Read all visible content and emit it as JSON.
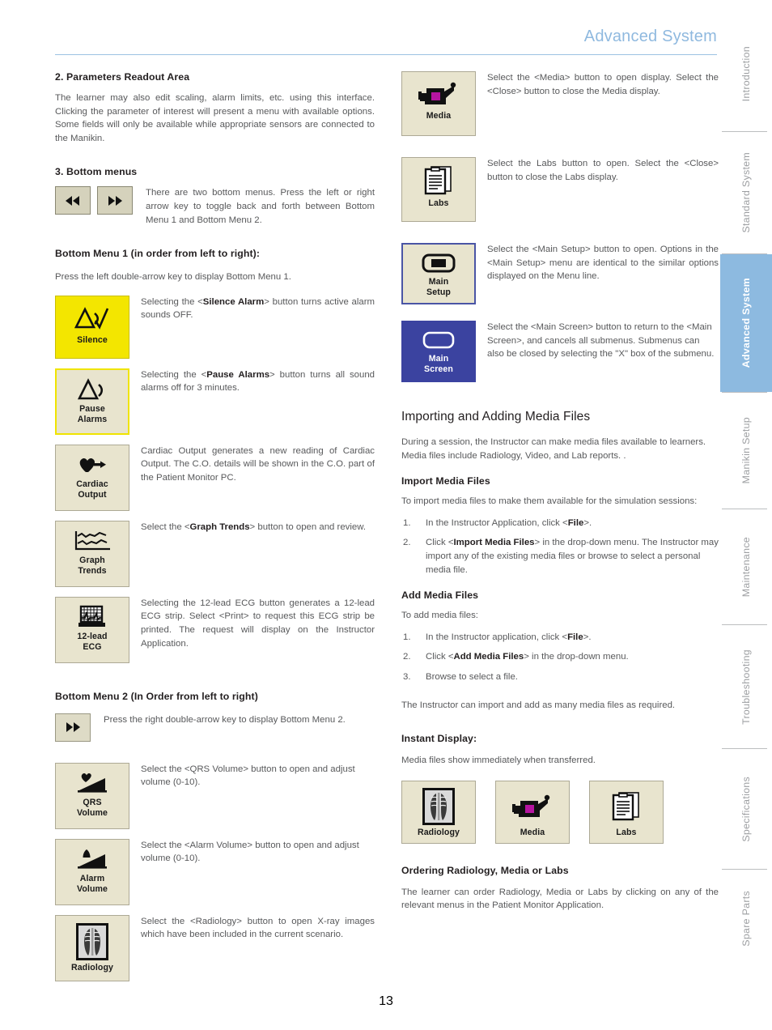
{
  "header": {
    "title": "Advanced System"
  },
  "page_number": "13",
  "colors": {
    "header_blue": "#8FB9DF",
    "active_tab": "#8DBAE0",
    "button_beige": "#E8E4CE",
    "silence_yellow": "#F3E600",
    "main_screen_blue": "#3B43A0"
  },
  "sidebar": {
    "tabs": [
      {
        "label": "Introduction",
        "active": false
      },
      {
        "label": "Standard System",
        "active": false
      },
      {
        "label": "Advanced System",
        "active": true
      },
      {
        "label": "Manikin Setup",
        "active": false
      },
      {
        "label": "Maintenance",
        "active": false
      },
      {
        "label": "Troubleshooting",
        "active": false
      },
      {
        "label": "Specifications",
        "active": false
      },
      {
        "label": "Spare Parts",
        "active": false
      }
    ]
  },
  "left_column": {
    "section2_heading": "2.  Parameters Readout  Area",
    "section2_body": "The learner may also edit scaling, alarm limits, etc. using this interface. Clicking the parameter of interest will present a menu with available options. Some fields will only be available while appropriate sensors are connected to the Manikin.",
    "section3_heading": "3.  Bottom menus",
    "bottom_menus_text": "There are two bottom menus.  Press the left or right arrow key to toggle back and forth between Bottom Menu 1 and Bottom Menu 2.",
    "bottom_menu1_heading": "Bottom Menu 1 (in order from left to right):",
    "bottom_menu1_intro": "Press the left double-arrow key to display Bottom Menu 1.",
    "buttons": [
      {
        "label": "Silence",
        "icon": "silence-alarm-icon",
        "style": "yellow",
        "desc_pre": "Selecting the <",
        "desc_bold": "Silence Alarm",
        "desc_post": "> button turns active alarm sounds OFF."
      },
      {
        "label_line1": "Pause",
        "label_line2": "Alarms",
        "icon": "pause-alarms-icon",
        "style": "yellow-border",
        "desc_pre": "Selecting the <",
        "desc_bold": "Pause Alarms",
        "desc_post": "> button turns all sound alarms off for 3 minutes."
      },
      {
        "label_line1": "Cardiac",
        "label_line2": "Output",
        "icon": "cardiac-output-icon",
        "style": "plain",
        "desc": "Cardiac Output generates a new reading of Cardiac Output. The C.O. details will be shown in the C.O. part of the Patient Monitor PC."
      },
      {
        "label_line1": "Graph",
        "label_line2": "Trends",
        "icon": "graph-trends-icon",
        "style": "plain",
        "desc_pre": "Select the <",
        "desc_bold": "Graph Trends",
        "desc_post": "> button  to open and review."
      },
      {
        "label_line1": "12-lead",
        "label_line2": "ECG",
        "icon": "twelve-lead-ecg-icon",
        "style": "plain",
        "desc": "Selecting the 12-lead ECG button generates a 12-lead ECG strip.  Select <Print> to request this ECG strip be printed.  The request will display on the Instructor Application."
      }
    ],
    "bottom_menu2_heading": "Bottom Menu 2 (In Order from left to right)",
    "bottom_menu2_intro": "Press the right double-arrow key to display Bottom Menu 2.",
    "buttons2": [
      {
        "label_line1": "QRS",
        "label_line2": "Volume",
        "icon": "qrs-volume-icon",
        "desc": "Select the <QRS Volume> button to open and adjust volume (0-10)."
      },
      {
        "label_line1": "Alarm",
        "label_line2": "Volume",
        "icon": "alarm-volume-icon",
        "desc": "Select the <Alarm Volume> button to open and adjust volume (0-10)."
      },
      {
        "label": "Radiology",
        "icon": "radiology-xray-icon",
        "desc": "Select the <Radiology> button to open X-ray images which have been included in the current scenario."
      }
    ]
  },
  "right_column": {
    "buttons": [
      {
        "label": "Media",
        "icon": "media-camcorder-icon",
        "style": "plain",
        "desc": "Select the <Media> button to open display.  Select the <Close> button to close the Media display."
      },
      {
        "label": "Labs",
        "icon": "labs-documents-icon",
        "style": "plain",
        "desc": "Select the Labs button to open. Select the <Close> button to close the Labs display."
      },
      {
        "label_line1": "Main",
        "label_line2": "Setup",
        "icon": "main-setup-icon",
        "style": "blue-border",
        "desc": "Select the <Main Setup> button to open. Options in the <Main Setup> menu are identical to the similar options displayed on the Menu line."
      },
      {
        "label_line1": "Main",
        "label_line2": "Screen",
        "icon": "main-screen-icon",
        "style": "blue-fill",
        "desc": "Select the <Main Screen> button to return to the <Main Screen>, and cancels all submenus. Submenus can also be closed by selecting the \"X\" box of the submenu."
      }
    ],
    "importing_heading": "Importing and Adding Media Files",
    "importing_body": "During a session, the Instructor can make media files available to learners. Media files include Radiology, Video, and Lab reports. .",
    "import_heading": "Import Media Files",
    "import_intro": "To import media files to make them available for the simulation sessions:",
    "import_steps": [
      {
        "num": "1.",
        "pre": "In the Instructor Application, click <",
        "bold": "File",
        "post": ">."
      },
      {
        "num": "2.",
        "pre": "Click <",
        "bold": "Import Media Files",
        "post": "> in the drop-down menu. The Instructor may import any of the existing media files or browse to select a personal media file."
      }
    ],
    "add_heading": "Add Media Files",
    "add_intro": "To add media files:",
    "add_steps": [
      {
        "num": "1.",
        "pre": "In the Instructor application, click  <",
        "bold": "File",
        "post": ">."
      },
      {
        "num": "2.",
        "pre": "Click <",
        "bold": "Add Media Files",
        "post": "> in the  drop-down menu."
      },
      {
        "num": "3.",
        "pre": "Browse to select a file.",
        "bold": "",
        "post": ""
      }
    ],
    "add_closing": "The Instructor can import and add as many media files as required.",
    "instant_heading": "Instant Display:",
    "instant_body": "Media files show immediately when transferred.",
    "instant_buttons": [
      {
        "label": "Radiology",
        "icon": "radiology-xray-icon"
      },
      {
        "label": "Media",
        "icon": "media-camcorder-icon"
      },
      {
        "label": "Labs",
        "icon": "labs-documents-icon"
      }
    ],
    "ordering_heading": "Ordering Radiology, Media or Labs",
    "ordering_body": "The learner can order Radiology, Media or Labs by clicking on any of the relevant menus in the Patient Monitor Application."
  }
}
